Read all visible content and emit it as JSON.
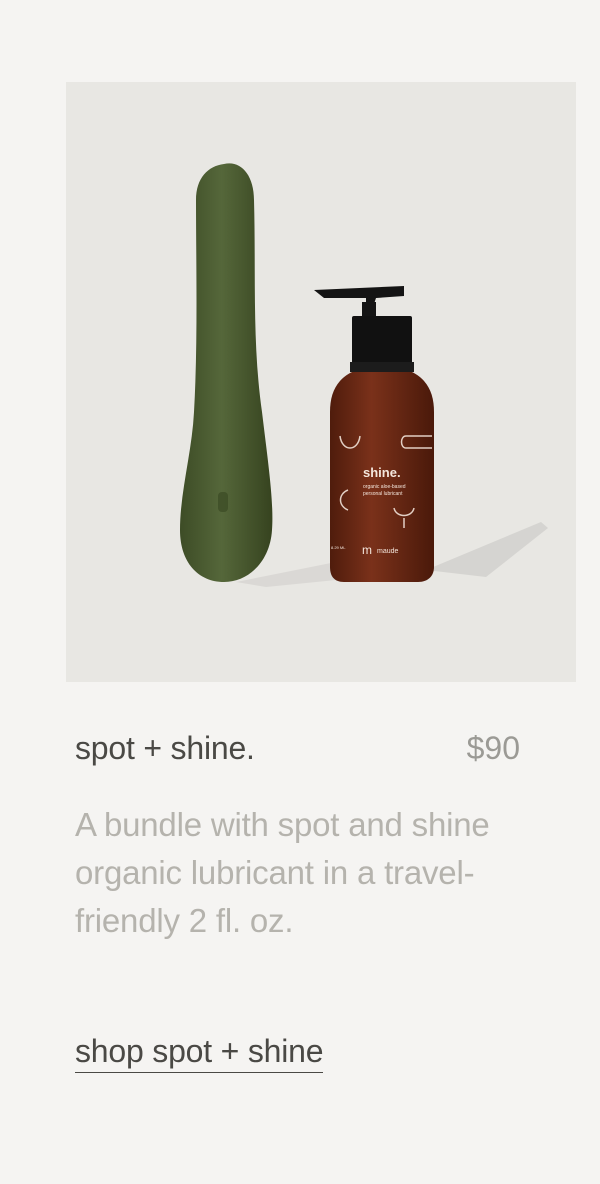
{
  "product": {
    "image_alt": "spot vibrator and shine organic lubricant bottle",
    "bottle_label": {
      "name": "shine.",
      "subtitle_line1": "organic aloe-based",
      "subtitle_line2": "personal lubricant",
      "brand": "maude",
      "volume": "8.29 ML"
    },
    "title": "spot + shine.",
    "price": "$90",
    "description": "A bundle with spot and shine organic lubricant in a travel-friendly 2 fl. oz.",
    "cta_label": "shop spot + shine"
  },
  "colors": {
    "background": "#f5f4f2",
    "image_background": "#e8e7e3",
    "vibrator": "#4a5a30",
    "bottle": "#6e2a14",
    "title_text": "#4a4945",
    "muted_text": "#b5b3ad"
  }
}
